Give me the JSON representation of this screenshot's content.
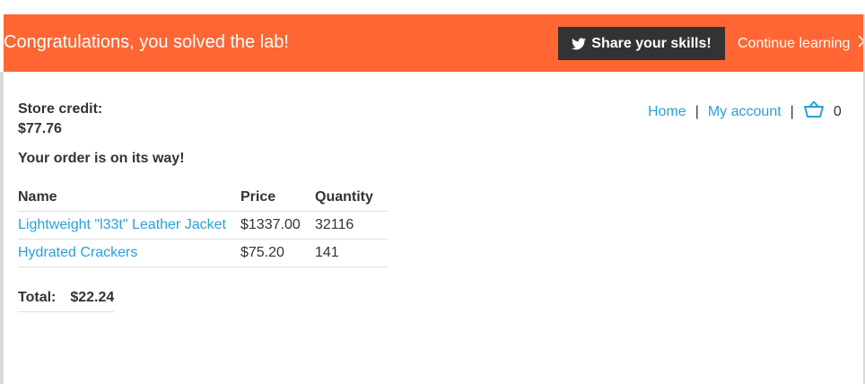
{
  "banner": {
    "message": "Congratulations, you solved the lab!",
    "share_label": "Share your skills!",
    "continue_label": "Continue learning",
    "share_icon": "twitter-bird-icon",
    "continue_icon": "chevron-right-icon",
    "background_color": "#ff6633"
  },
  "account": {
    "store_credit_label": "Store credit:",
    "store_credit_value": "$77.76"
  },
  "nav": {
    "home": "Home",
    "separator": "|",
    "my_account": "My account",
    "cart_icon": "basket-icon",
    "cart_count": "0"
  },
  "order": {
    "status_message": "Your order is on its way!",
    "columns": [
      "Name",
      "Price",
      "Quantity"
    ],
    "rows": [
      {
        "name": "Lightweight \"l33t\" Leather Jacket",
        "price": "$1337.00",
        "quantity": "32116"
      },
      {
        "name": "Hydrated Crackers",
        "price": "$75.20",
        "quantity": "141"
      }
    ],
    "total_label": "Total:",
    "total_value": "$22.24"
  },
  "colors": {
    "link": "#29a0d6",
    "text": "#333333"
  }
}
